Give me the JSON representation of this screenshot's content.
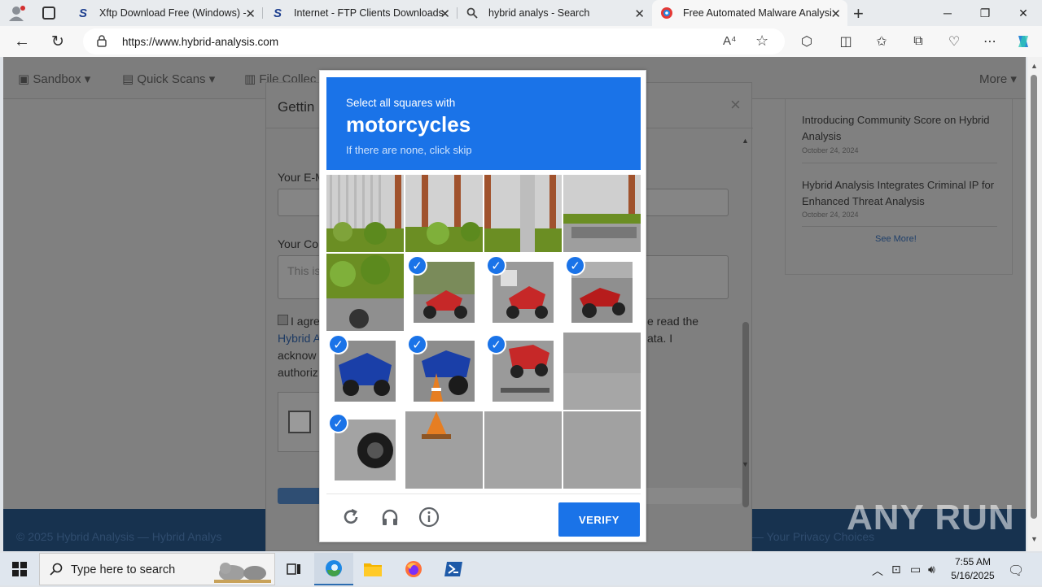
{
  "browser": {
    "tabs": [
      {
        "title": "Xftp Download Free (Windows) -",
        "icon": "softpedia-icon"
      },
      {
        "title": "Internet - FTP Clients Downloads",
        "icon": "softpedia-icon"
      },
      {
        "title": "hybrid analys - Search",
        "icon": "search-icon"
      },
      {
        "title": "Free Automated Malware Analysi",
        "icon": "hybrid-analysis-icon"
      }
    ],
    "url": "https://www.hybrid-analysis.com",
    "read_aloud_label": "A⁴"
  },
  "site": {
    "nav": {
      "sandbox": "Sandbox",
      "quick_scans": "Quick Scans",
      "file_collections": "File Collec",
      "more": "More"
    },
    "news": [
      {
        "title": "Introducing Community Score on Hybrid Analysis",
        "date": "October 24, 2024"
      },
      {
        "title": "Hybrid Analysis Integrates Criminal IP for Enhanced Threat Analysis",
        "date": "October 24, 2024"
      }
    ],
    "see_more": "See More!",
    "footer": {
      "left": "© 2025 Hybrid Analysis — Hybrid Analys",
      "right": "— Your Privacy Choices"
    }
  },
  "modal": {
    "title": "Gettin",
    "email_label": "Your E-M",
    "comment_label": "Your Co",
    "comment_placeholder": "This is",
    "agree_1": "I agre",
    "agree_link": "Hybrid A",
    "agree_3": "acknow",
    "agree_4": "authoriz",
    "agree_right_1": "e read the",
    "agree_right_2": "ata. I",
    "close": "×"
  },
  "captcha": {
    "prompt_prefix": "Select all squares with",
    "object": "motorcycles",
    "hint": "If there are none, click skip",
    "verify_label": "VERIFY",
    "selected": [
      false,
      false,
      false,
      false,
      false,
      true,
      true,
      true,
      true,
      true,
      true,
      false,
      true,
      false,
      false,
      false
    ]
  },
  "watermark": "ANY RUN",
  "taskbar": {
    "search_placeholder": "Type here to search",
    "time": "7:55 AM",
    "date": "5/16/2025"
  },
  "colors": {
    "captcha_blue": "#1a73e8",
    "footer_navy": "#17324f"
  }
}
